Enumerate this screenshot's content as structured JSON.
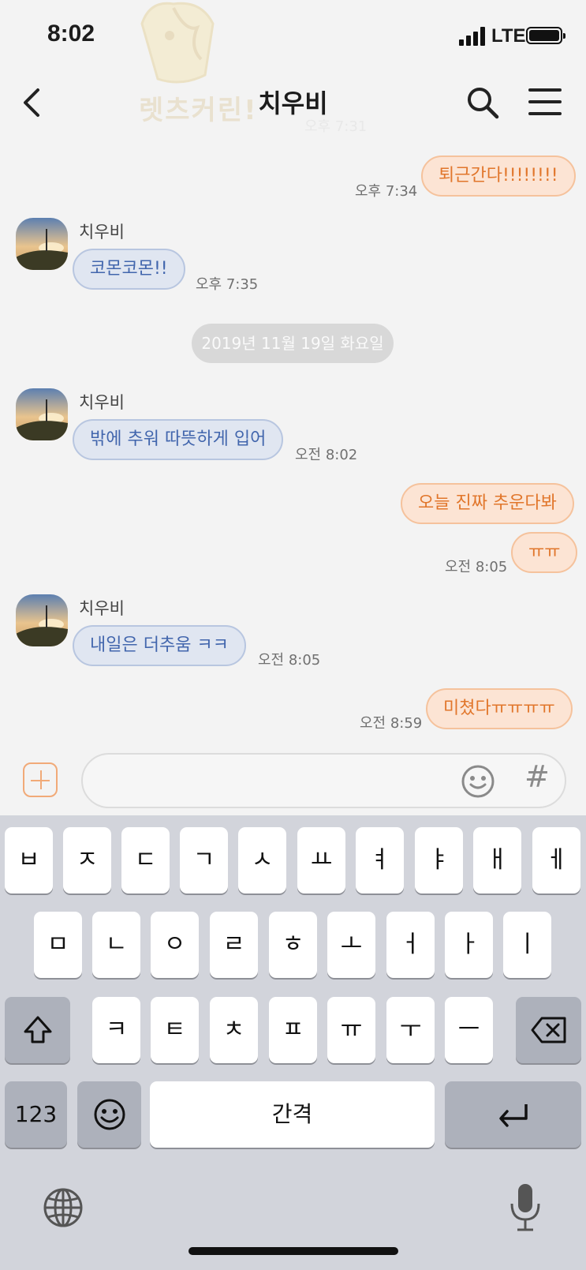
{
  "status_bar": {
    "time": "8:02",
    "network": "LTE"
  },
  "watermark": {
    "text": "렛츠커린!"
  },
  "header": {
    "title": "치우비"
  },
  "messages": [
    {
      "side": "me",
      "text": "퇴근간다!!!!!!!!",
      "time": "오후 7:34"
    },
    {
      "side": "them",
      "sender": "치우비",
      "text": "코몬코몬!!",
      "time": "오후 7:35"
    },
    {
      "side": "them",
      "sender": "치우비",
      "text": "밖에 추워 따뜻하게 입어",
      "time": "오전 8:02"
    },
    {
      "side": "me",
      "text": "오늘 진짜 추운다봐"
    },
    {
      "side": "me",
      "text": "ㅠㅠ",
      "time": "오전 8:05"
    },
    {
      "side": "them",
      "sender": "치우비",
      "text": "내일은 더추움 ㅋㅋ",
      "time": "오전 8:05"
    },
    {
      "side": "me",
      "text": "미쳤다ㅠㅠㅠㅠ",
      "time": "오전 8:59"
    }
  ],
  "faded_time": "오후 7:31",
  "date_divider": "2019년 11월 19일 화요일",
  "input": {
    "value": "",
    "hash_label": "#"
  },
  "keyboard": {
    "row1": [
      "ㅂ",
      "ㅈ",
      "ㄷ",
      "ㄱ",
      "ㅅ",
      "ㅛ",
      "ㅕ",
      "ㅑ",
      "ㅐ",
      "ㅔ"
    ],
    "row2": [
      "ㅁ",
      "ㄴ",
      "ㅇ",
      "ㄹ",
      "ㅎ",
      "ㅗ",
      "ㅓ",
      "ㅏ",
      "ㅣ"
    ],
    "row3": [
      "ㅋ",
      "ㅌ",
      "ㅊ",
      "ㅍ",
      "ㅠ",
      "ㅜ",
      "ㅡ"
    ],
    "numbers_label": "123",
    "space_label": "간격"
  },
  "colors": {
    "me_bubble": "#fce4d4",
    "me_text": "#e1762b",
    "them_bubble": "#e0e6f1",
    "them_text": "#4266ad"
  }
}
